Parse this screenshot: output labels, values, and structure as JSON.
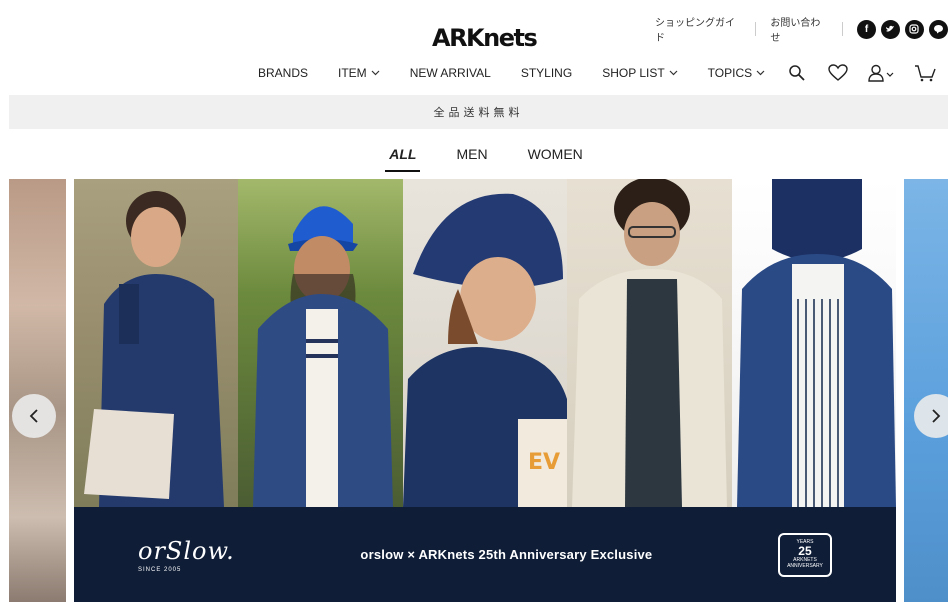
{
  "header": {
    "logo": "ARKnets",
    "util_links": [
      "ショッピングガイド",
      "お問い合わせ"
    ],
    "social_icons": [
      "facebook-icon",
      "twitter-icon",
      "instagram-icon",
      "line-icon"
    ]
  },
  "nav": [
    {
      "label": "BRANDS",
      "dropdown": false
    },
    {
      "label": "ITEM",
      "dropdown": true
    },
    {
      "label": "NEW ARRIVAL",
      "dropdown": false
    },
    {
      "label": "STYLING",
      "dropdown": false
    },
    {
      "label": "SHOP LIST",
      "dropdown": true
    },
    {
      "label": "TOPICS",
      "dropdown": true
    }
  ],
  "notice": "全品送料無料",
  "tabs": [
    "ALL",
    "MEN",
    "WOMEN"
  ],
  "active_tab": "ALL",
  "banner": {
    "brand": "orSlow.",
    "brand_sub": "SINCE 2005",
    "headline": "orslow × ARKnets 25th Anniversary Exclusive",
    "badge_number": "25",
    "badge_top": "YEARS",
    "badge_brand": "ARKNETS",
    "badge_bottom": "ANNIVERSARY"
  },
  "colors": {
    "banner_band": "#0f1d37",
    "notice_bar": "#f0f0f0"
  }
}
